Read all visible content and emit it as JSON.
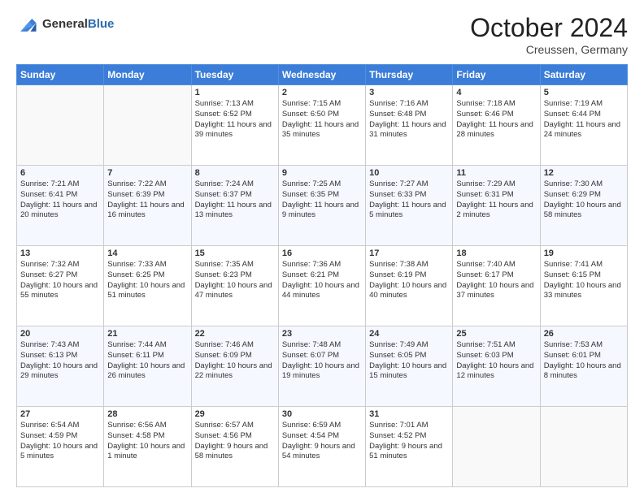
{
  "header": {
    "logo_general": "General",
    "logo_blue": "Blue",
    "month_title": "October 2024",
    "subtitle": "Creussen, Germany"
  },
  "days_of_week": [
    "Sunday",
    "Monday",
    "Tuesday",
    "Wednesday",
    "Thursday",
    "Friday",
    "Saturday"
  ],
  "weeks": [
    [
      null,
      null,
      {
        "day": "1",
        "sunrise": "7:13 AM",
        "sunset": "6:52 PM",
        "daylight": "11 hours and 39 minutes."
      },
      {
        "day": "2",
        "sunrise": "7:15 AM",
        "sunset": "6:50 PM",
        "daylight": "11 hours and 35 minutes."
      },
      {
        "day": "3",
        "sunrise": "7:16 AM",
        "sunset": "6:48 PM",
        "daylight": "11 hours and 31 minutes."
      },
      {
        "day": "4",
        "sunrise": "7:18 AM",
        "sunset": "6:46 PM",
        "daylight": "11 hours and 28 minutes."
      },
      {
        "day": "5",
        "sunrise": "7:19 AM",
        "sunset": "6:44 PM",
        "daylight": "11 hours and 24 minutes."
      }
    ],
    [
      {
        "day": "6",
        "sunrise": "7:21 AM",
        "sunset": "6:41 PM",
        "daylight": "11 hours and 20 minutes."
      },
      {
        "day": "7",
        "sunrise": "7:22 AM",
        "sunset": "6:39 PM",
        "daylight": "11 hours and 16 minutes."
      },
      {
        "day": "8",
        "sunrise": "7:24 AM",
        "sunset": "6:37 PM",
        "daylight": "11 hours and 13 minutes."
      },
      {
        "day": "9",
        "sunrise": "7:25 AM",
        "sunset": "6:35 PM",
        "daylight": "11 hours and 9 minutes."
      },
      {
        "day": "10",
        "sunrise": "7:27 AM",
        "sunset": "6:33 PM",
        "daylight": "11 hours and 5 minutes."
      },
      {
        "day": "11",
        "sunrise": "7:29 AM",
        "sunset": "6:31 PM",
        "daylight": "11 hours and 2 minutes."
      },
      {
        "day": "12",
        "sunrise": "7:30 AM",
        "sunset": "6:29 PM",
        "daylight": "10 hours and 58 minutes."
      }
    ],
    [
      {
        "day": "13",
        "sunrise": "7:32 AM",
        "sunset": "6:27 PM",
        "daylight": "10 hours and 55 minutes."
      },
      {
        "day": "14",
        "sunrise": "7:33 AM",
        "sunset": "6:25 PM",
        "daylight": "10 hours and 51 minutes."
      },
      {
        "day": "15",
        "sunrise": "7:35 AM",
        "sunset": "6:23 PM",
        "daylight": "10 hours and 47 minutes."
      },
      {
        "day": "16",
        "sunrise": "7:36 AM",
        "sunset": "6:21 PM",
        "daylight": "10 hours and 44 minutes."
      },
      {
        "day": "17",
        "sunrise": "7:38 AM",
        "sunset": "6:19 PM",
        "daylight": "10 hours and 40 minutes."
      },
      {
        "day": "18",
        "sunrise": "7:40 AM",
        "sunset": "6:17 PM",
        "daylight": "10 hours and 37 minutes."
      },
      {
        "day": "19",
        "sunrise": "7:41 AM",
        "sunset": "6:15 PM",
        "daylight": "10 hours and 33 minutes."
      }
    ],
    [
      {
        "day": "20",
        "sunrise": "7:43 AM",
        "sunset": "6:13 PM",
        "daylight": "10 hours and 29 minutes."
      },
      {
        "day": "21",
        "sunrise": "7:44 AM",
        "sunset": "6:11 PM",
        "daylight": "10 hours and 26 minutes."
      },
      {
        "day": "22",
        "sunrise": "7:46 AM",
        "sunset": "6:09 PM",
        "daylight": "10 hours and 22 minutes."
      },
      {
        "day": "23",
        "sunrise": "7:48 AM",
        "sunset": "6:07 PM",
        "daylight": "10 hours and 19 minutes."
      },
      {
        "day": "24",
        "sunrise": "7:49 AM",
        "sunset": "6:05 PM",
        "daylight": "10 hours and 15 minutes."
      },
      {
        "day": "25",
        "sunrise": "7:51 AM",
        "sunset": "6:03 PM",
        "daylight": "10 hours and 12 minutes."
      },
      {
        "day": "26",
        "sunrise": "7:53 AM",
        "sunset": "6:01 PM",
        "daylight": "10 hours and 8 minutes."
      }
    ],
    [
      {
        "day": "27",
        "sunrise": "6:54 AM",
        "sunset": "4:59 PM",
        "daylight": "10 hours and 5 minutes."
      },
      {
        "day": "28",
        "sunrise": "6:56 AM",
        "sunset": "4:58 PM",
        "daylight": "10 hours and 1 minute."
      },
      {
        "day": "29",
        "sunrise": "6:57 AM",
        "sunset": "4:56 PM",
        "daylight": "9 hours and 58 minutes."
      },
      {
        "day": "30",
        "sunrise": "6:59 AM",
        "sunset": "4:54 PM",
        "daylight": "9 hours and 54 minutes."
      },
      {
        "day": "31",
        "sunrise": "7:01 AM",
        "sunset": "4:52 PM",
        "daylight": "9 hours and 51 minutes."
      },
      null,
      null
    ]
  ],
  "labels": {
    "sunrise": "Sunrise:",
    "sunset": "Sunset:",
    "daylight": "Daylight:"
  }
}
